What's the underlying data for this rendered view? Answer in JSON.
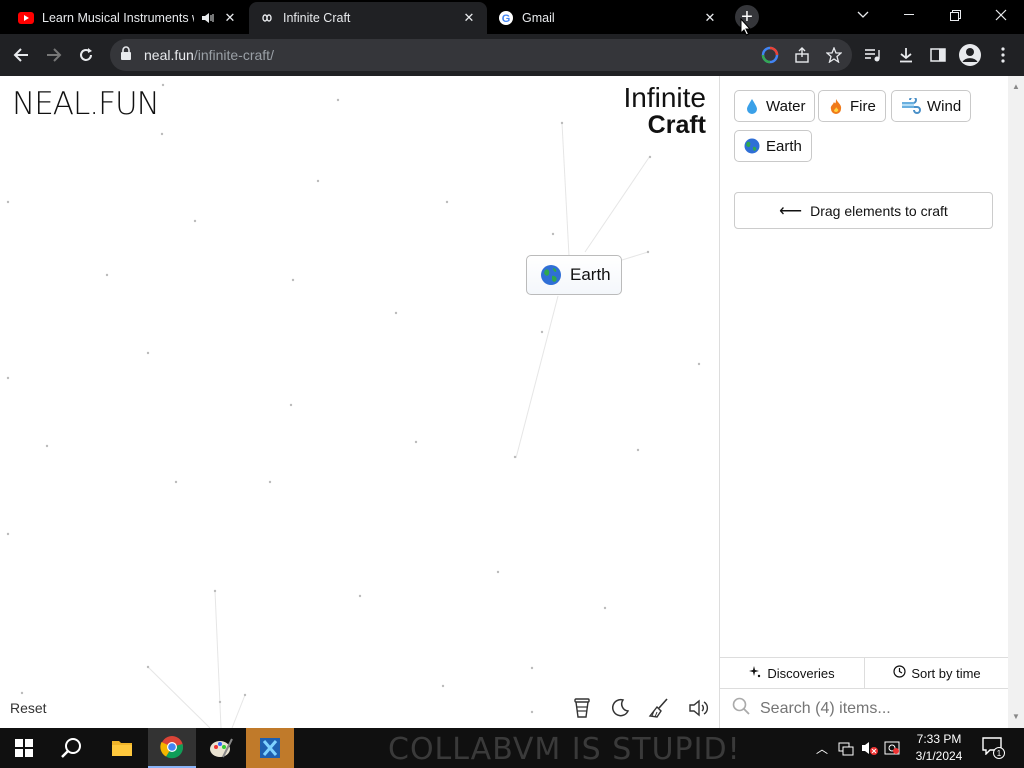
{
  "browser": {
    "tabs": [
      {
        "title": "Learn Musical Instruments w",
        "icon": "youtube-icon",
        "muted_icon": "speaker-icon"
      },
      {
        "title": "Infinite Craft",
        "icon": "infinity-icon",
        "active": true
      },
      {
        "title": "Gmail",
        "icon": "google-icon"
      }
    ],
    "url_host": "neal.fun",
    "url_path": "/infinite-craft/"
  },
  "page": {
    "brand_left": "NEAL.FUN",
    "brand_right_line1": "Infinite",
    "brand_right_line2": "Craft",
    "canvas_item": {
      "label": "Earth",
      "emoji": "earth-globe-icon"
    },
    "items": [
      {
        "label": "Water",
        "emoji": "droplet-icon"
      },
      {
        "label": "Fire",
        "emoji": "fire-icon"
      },
      {
        "label": "Wind",
        "emoji": "wind-icon"
      },
      {
        "label": "Earth",
        "emoji": "earth-globe-icon"
      }
    ],
    "hint": "Drag elements to craft",
    "discoveries_label": "Discoveries",
    "sort_label": "Sort by time",
    "search_placeholder": "Search (4) items...",
    "reset_label": "Reset"
  },
  "taskbar": {
    "watermark": "COLLABVM IS STUPID!",
    "time": "7:33 PM",
    "date": "3/1/2024",
    "notification_count": "1"
  },
  "colors": {
    "accent_youtube": "#ff0000",
    "chrome_dark": "#202124",
    "taskbar": "#101010"
  }
}
